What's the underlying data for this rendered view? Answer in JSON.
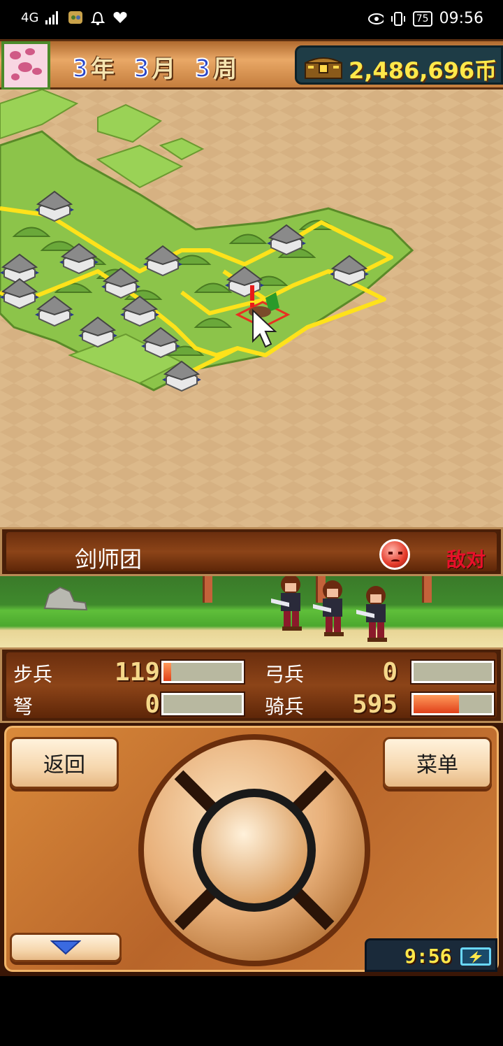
{
  "status_bar": {
    "network": "4G",
    "battery": "75",
    "time": "09:56"
  },
  "header": {
    "year_num": "3",
    "year_unit": "年",
    "month_num": "3",
    "month_unit": "月",
    "week_num": "3",
    "week_unit": "周",
    "money": "2,486,696币"
  },
  "unit": {
    "name": "剑师团",
    "status": "敌对"
  },
  "troops": [
    {
      "label": "步兵",
      "value": "119",
      "fill": 0.1
    },
    {
      "label": "弓兵",
      "value": "0",
      "fill": 0
    },
    {
      "label": "弩",
      "value": "0",
      "fill": 0
    },
    {
      "label": "骑兵",
      "value": "595",
      "fill": 0.58
    }
  ],
  "controls": {
    "back_label": "返回",
    "menu_label": "菜单",
    "clock": "9:56"
  },
  "colors": {
    "enemy": "#e8102a",
    "money": "#ffe84a",
    "road": "#ffe21a"
  }
}
